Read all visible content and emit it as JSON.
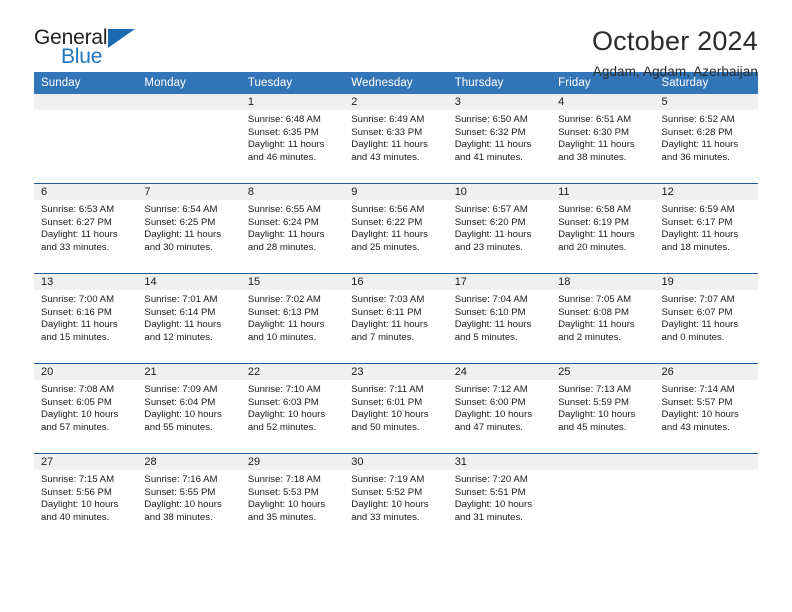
{
  "brand": {
    "name_part1": "General",
    "name_part2": "Blue",
    "triangle_color": "#1a6bb0",
    "blue_text_color": "#2077bd"
  },
  "header": {
    "month_title": "October 2024",
    "location": "Agdam, Agdam, Azerbaijan"
  },
  "theme": {
    "header_row_bg": "#3275b8",
    "row_separator": "#205d9e",
    "daynum_band_bg": "#f0f0f0"
  },
  "weekday_headers": [
    "Sunday",
    "Monday",
    "Tuesday",
    "Wednesday",
    "Thursday",
    "Friday",
    "Saturday"
  ],
  "weeks": [
    [
      {
        "day": "",
        "sunrise": "",
        "sunset": "",
        "daylight": "",
        "empty": true
      },
      {
        "day": "",
        "sunrise": "",
        "sunset": "",
        "daylight": "",
        "empty": true
      },
      {
        "day": "1",
        "sunrise": "Sunrise: 6:48 AM",
        "sunset": "Sunset: 6:35 PM",
        "daylight": "Daylight: 11 hours and 46 minutes."
      },
      {
        "day": "2",
        "sunrise": "Sunrise: 6:49 AM",
        "sunset": "Sunset: 6:33 PM",
        "daylight": "Daylight: 11 hours and 43 minutes."
      },
      {
        "day": "3",
        "sunrise": "Sunrise: 6:50 AM",
        "sunset": "Sunset: 6:32 PM",
        "daylight": "Daylight: 11 hours and 41 minutes."
      },
      {
        "day": "4",
        "sunrise": "Sunrise: 6:51 AM",
        "sunset": "Sunset: 6:30 PM",
        "daylight": "Daylight: 11 hours and 38 minutes."
      },
      {
        "day": "5",
        "sunrise": "Sunrise: 6:52 AM",
        "sunset": "Sunset: 6:28 PM",
        "daylight": "Daylight: 11 hours and 36 minutes."
      }
    ],
    [
      {
        "day": "6",
        "sunrise": "Sunrise: 6:53 AM",
        "sunset": "Sunset: 6:27 PM",
        "daylight": "Daylight: 11 hours and 33 minutes."
      },
      {
        "day": "7",
        "sunrise": "Sunrise: 6:54 AM",
        "sunset": "Sunset: 6:25 PM",
        "daylight": "Daylight: 11 hours and 30 minutes."
      },
      {
        "day": "8",
        "sunrise": "Sunrise: 6:55 AM",
        "sunset": "Sunset: 6:24 PM",
        "daylight": "Daylight: 11 hours and 28 minutes."
      },
      {
        "day": "9",
        "sunrise": "Sunrise: 6:56 AM",
        "sunset": "Sunset: 6:22 PM",
        "daylight": "Daylight: 11 hours and 25 minutes."
      },
      {
        "day": "10",
        "sunrise": "Sunrise: 6:57 AM",
        "sunset": "Sunset: 6:20 PM",
        "daylight": "Daylight: 11 hours and 23 minutes."
      },
      {
        "day": "11",
        "sunrise": "Sunrise: 6:58 AM",
        "sunset": "Sunset: 6:19 PM",
        "daylight": "Daylight: 11 hours and 20 minutes."
      },
      {
        "day": "12",
        "sunrise": "Sunrise: 6:59 AM",
        "sunset": "Sunset: 6:17 PM",
        "daylight": "Daylight: 11 hours and 18 minutes."
      }
    ],
    [
      {
        "day": "13",
        "sunrise": "Sunrise: 7:00 AM",
        "sunset": "Sunset: 6:16 PM",
        "daylight": "Daylight: 11 hours and 15 minutes."
      },
      {
        "day": "14",
        "sunrise": "Sunrise: 7:01 AM",
        "sunset": "Sunset: 6:14 PM",
        "daylight": "Daylight: 11 hours and 12 minutes."
      },
      {
        "day": "15",
        "sunrise": "Sunrise: 7:02 AM",
        "sunset": "Sunset: 6:13 PM",
        "daylight": "Daylight: 11 hours and 10 minutes."
      },
      {
        "day": "16",
        "sunrise": "Sunrise: 7:03 AM",
        "sunset": "Sunset: 6:11 PM",
        "daylight": "Daylight: 11 hours and 7 minutes."
      },
      {
        "day": "17",
        "sunrise": "Sunrise: 7:04 AM",
        "sunset": "Sunset: 6:10 PM",
        "daylight": "Daylight: 11 hours and 5 minutes."
      },
      {
        "day": "18",
        "sunrise": "Sunrise: 7:05 AM",
        "sunset": "Sunset: 6:08 PM",
        "daylight": "Daylight: 11 hours and 2 minutes."
      },
      {
        "day": "19",
        "sunrise": "Sunrise: 7:07 AM",
        "sunset": "Sunset: 6:07 PM",
        "daylight": "Daylight: 11 hours and 0 minutes."
      }
    ],
    [
      {
        "day": "20",
        "sunrise": "Sunrise: 7:08 AM",
        "sunset": "Sunset: 6:05 PM",
        "daylight": "Daylight: 10 hours and 57 minutes."
      },
      {
        "day": "21",
        "sunrise": "Sunrise: 7:09 AM",
        "sunset": "Sunset: 6:04 PM",
        "daylight": "Daylight: 10 hours and 55 minutes."
      },
      {
        "day": "22",
        "sunrise": "Sunrise: 7:10 AM",
        "sunset": "Sunset: 6:03 PM",
        "daylight": "Daylight: 10 hours and 52 minutes."
      },
      {
        "day": "23",
        "sunrise": "Sunrise: 7:11 AM",
        "sunset": "Sunset: 6:01 PM",
        "daylight": "Daylight: 10 hours and 50 minutes."
      },
      {
        "day": "24",
        "sunrise": "Sunrise: 7:12 AM",
        "sunset": "Sunset: 6:00 PM",
        "daylight": "Daylight: 10 hours and 47 minutes."
      },
      {
        "day": "25",
        "sunrise": "Sunrise: 7:13 AM",
        "sunset": "Sunset: 5:59 PM",
        "daylight": "Daylight: 10 hours and 45 minutes."
      },
      {
        "day": "26",
        "sunrise": "Sunrise: 7:14 AM",
        "sunset": "Sunset: 5:57 PM",
        "daylight": "Daylight: 10 hours and 43 minutes."
      }
    ],
    [
      {
        "day": "27",
        "sunrise": "Sunrise: 7:15 AM",
        "sunset": "Sunset: 5:56 PM",
        "daylight": "Daylight: 10 hours and 40 minutes."
      },
      {
        "day": "28",
        "sunrise": "Sunrise: 7:16 AM",
        "sunset": "Sunset: 5:55 PM",
        "daylight": "Daylight: 10 hours and 38 minutes."
      },
      {
        "day": "29",
        "sunrise": "Sunrise: 7:18 AM",
        "sunset": "Sunset: 5:53 PM",
        "daylight": "Daylight: 10 hours and 35 minutes."
      },
      {
        "day": "30",
        "sunrise": "Sunrise: 7:19 AM",
        "sunset": "Sunset: 5:52 PM",
        "daylight": "Daylight: 10 hours and 33 minutes."
      },
      {
        "day": "31",
        "sunrise": "Sunrise: 7:20 AM",
        "sunset": "Sunset: 5:51 PM",
        "daylight": "Daylight: 10 hours and 31 minutes."
      },
      {
        "day": "",
        "sunrise": "",
        "sunset": "",
        "daylight": "",
        "empty": true
      },
      {
        "day": "",
        "sunrise": "",
        "sunset": "",
        "daylight": "",
        "empty": true
      }
    ]
  ]
}
